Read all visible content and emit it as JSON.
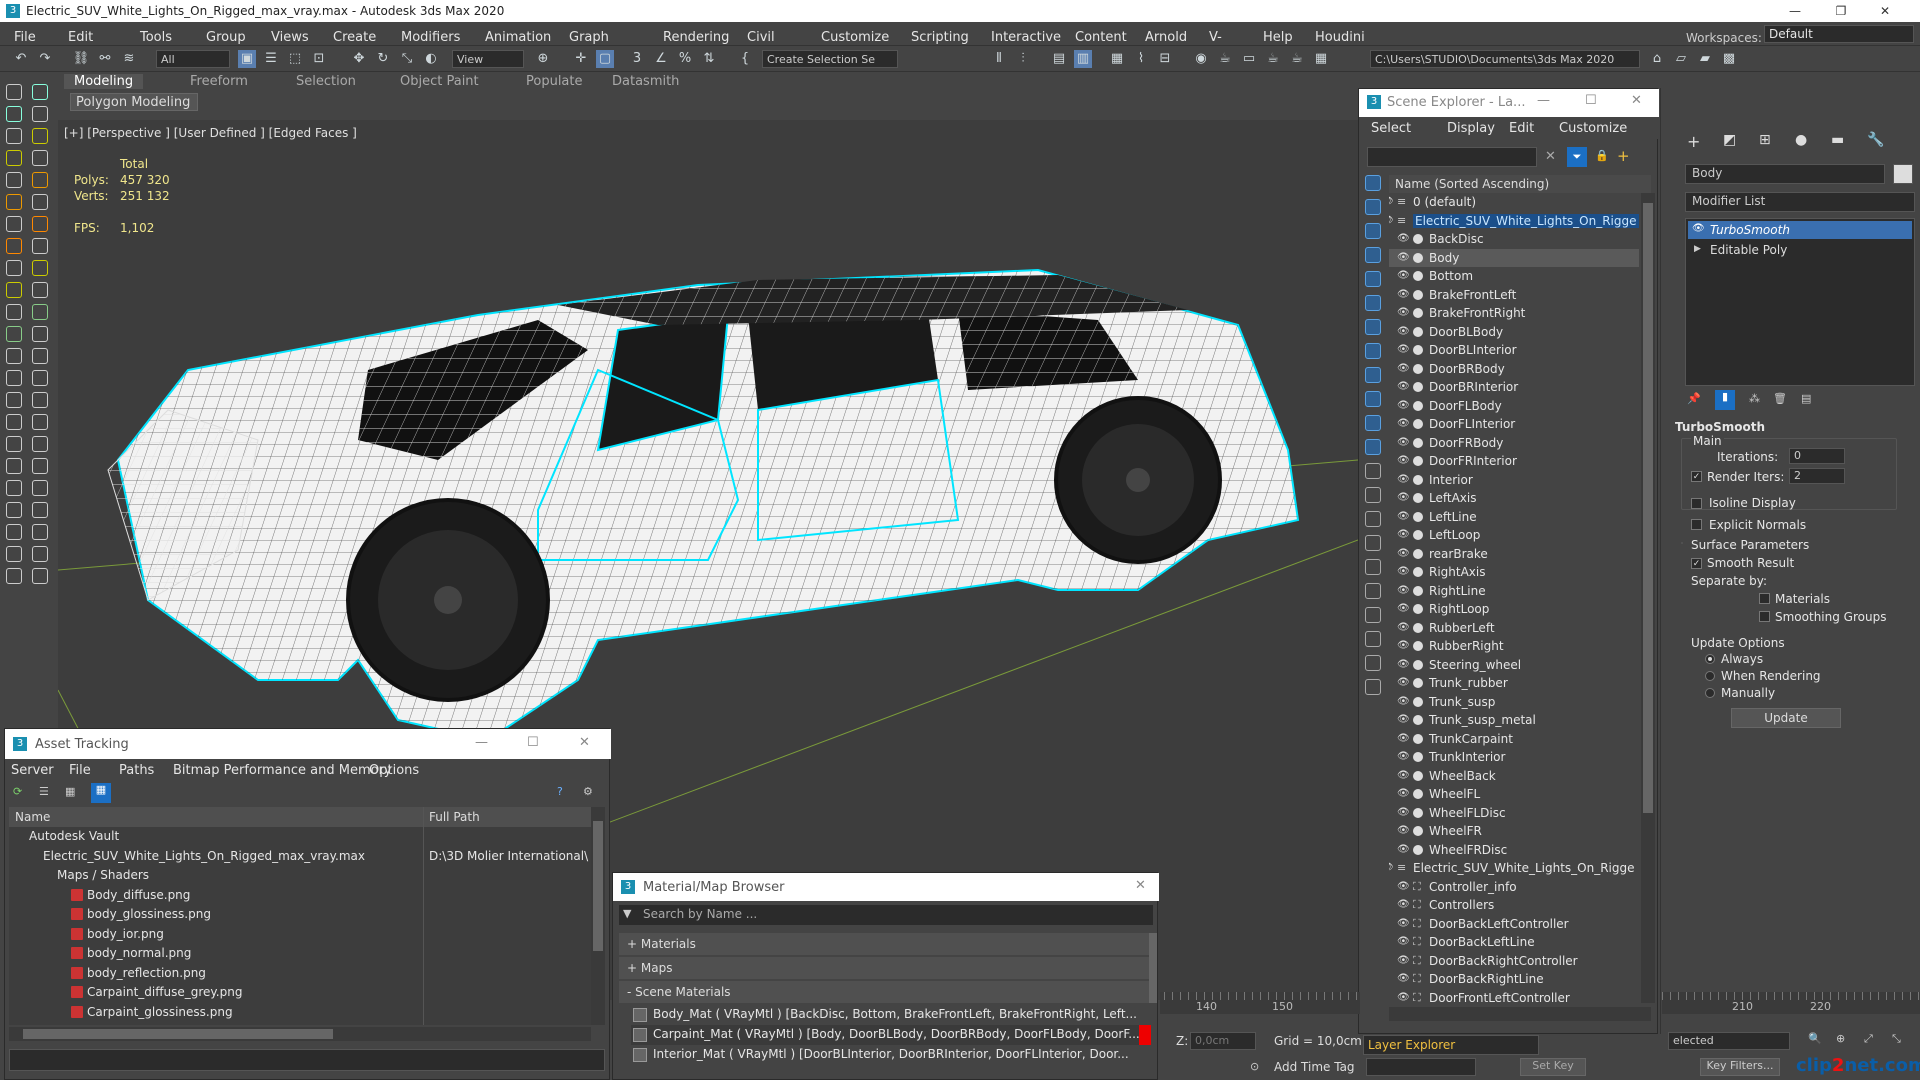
{
  "window": {
    "title": "Electric_SUV_White_Lights_On_Rigged_max_vray.max - Autodesk 3ds Max 2020"
  },
  "menu": [
    "File",
    "Edit",
    "Tools",
    "Group",
    "Views",
    "Create",
    "Modifiers",
    "Animation",
    "Graph Editors",
    "Rendering",
    "Civil View",
    "Customize",
    "Scripting",
    "Interactive",
    "Content",
    "Arnold",
    "V-Ray",
    "Help",
    "Houdini Engine"
  ],
  "workspaces": {
    "label": "Workspaces:",
    "value": "Default"
  },
  "toolbar": {
    "filter": "All",
    "view": "View",
    "selection_set": "Create Selection Se",
    "path": "C:\\Users\\STUDIO\\Documents\\3ds Max 2020"
  },
  "ribbon": {
    "tabs": [
      "Modeling",
      "Freeform",
      "Selection",
      "Object Paint",
      "Populate",
      "Datasmith"
    ],
    "sub": "Polygon Modeling"
  },
  "viewport": {
    "label": "[+] [Perspective ] [User Defined ] [Edged Faces ]",
    "stats": {
      "total": "Total",
      "polys_label": "Polys:",
      "polys": "457 320",
      "verts_label": "Verts:",
      "verts": "251 132",
      "fps_label": "FPS:",
      "fps": "1,102"
    }
  },
  "scene_explorer": {
    "title": "Scene Explorer - La...",
    "menu": [
      "Select",
      "Display",
      "Edit",
      "Customize"
    ],
    "column": "Name (Sorted Ascending)",
    "rows": [
      {
        "name": "0 (default)",
        "indent": 0,
        "type": "layer"
      },
      {
        "name": "Electric_SUV_White_Lights_On_Rigge",
        "indent": 0,
        "type": "layer-open",
        "hilite": true
      },
      {
        "name": "BackDisc",
        "indent": 1,
        "type": "obj"
      },
      {
        "name": "Body",
        "indent": 1,
        "type": "obj",
        "sel": true
      },
      {
        "name": "Bottom",
        "indent": 1,
        "type": "obj"
      },
      {
        "name": "BrakeFrontLeft",
        "indent": 1,
        "type": "obj"
      },
      {
        "name": "BrakeFrontRight",
        "indent": 1,
        "type": "obj"
      },
      {
        "name": "DoorBLBody",
        "indent": 1,
        "type": "obj"
      },
      {
        "name": "DoorBLInterior",
        "indent": 1,
        "type": "obj"
      },
      {
        "name": "DoorBRBody",
        "indent": 1,
        "type": "obj"
      },
      {
        "name": "DoorBRInterior",
        "indent": 1,
        "type": "obj"
      },
      {
        "name": "DoorFLBody",
        "indent": 1,
        "type": "obj"
      },
      {
        "name": "DoorFLInterior",
        "indent": 1,
        "type": "obj"
      },
      {
        "name": "DoorFRBody",
        "indent": 1,
        "type": "obj"
      },
      {
        "name": "DoorFRInterior",
        "indent": 1,
        "type": "obj"
      },
      {
        "name": "Interior",
        "indent": 1,
        "type": "obj"
      },
      {
        "name": "LeftAxis",
        "indent": 1,
        "type": "obj"
      },
      {
        "name": "LeftLine",
        "indent": 1,
        "type": "obj"
      },
      {
        "name": "LeftLoop",
        "indent": 1,
        "type": "obj"
      },
      {
        "name": "rearBrake",
        "indent": 1,
        "type": "obj"
      },
      {
        "name": "RightAxis",
        "indent": 1,
        "type": "obj"
      },
      {
        "name": "RightLine",
        "indent": 1,
        "type": "obj"
      },
      {
        "name": "RightLoop",
        "indent": 1,
        "type": "obj"
      },
      {
        "name": "RubberLeft",
        "indent": 1,
        "type": "obj"
      },
      {
        "name": "RubberRight",
        "indent": 1,
        "type": "obj"
      },
      {
        "name": "Steering_wheel",
        "indent": 1,
        "type": "obj"
      },
      {
        "name": "Trunk_rubber",
        "indent": 1,
        "type": "obj"
      },
      {
        "name": "Trunk_susp",
        "indent": 1,
        "type": "obj"
      },
      {
        "name": "Trunk_susp_metal",
        "indent": 1,
        "type": "obj"
      },
      {
        "name": "TrunkCarpaint",
        "indent": 1,
        "type": "obj"
      },
      {
        "name": "TrunkInterior",
        "indent": 1,
        "type": "obj"
      },
      {
        "name": "WheelBack",
        "indent": 1,
        "type": "obj"
      },
      {
        "name": "WheelFL",
        "indent": 1,
        "type": "obj"
      },
      {
        "name": "WheelFLDisc",
        "indent": 1,
        "type": "obj"
      },
      {
        "name": "WheelFR",
        "indent": 1,
        "type": "obj"
      },
      {
        "name": "WheelFRDisc",
        "indent": 1,
        "type": "obj"
      },
      {
        "name": "Electric_SUV_White_Lights_On_Rigge",
        "indent": 0,
        "type": "layer-open"
      },
      {
        "name": "Controller_info",
        "indent": 1,
        "type": "ctrl"
      },
      {
        "name": "Controllers",
        "indent": 1,
        "type": "ctrl"
      },
      {
        "name": "DoorBackLeftController",
        "indent": 1,
        "type": "ctrl"
      },
      {
        "name": "DoorBackLeftLine",
        "indent": 1,
        "type": "ctrl"
      },
      {
        "name": "DoorBackRightController",
        "indent": 1,
        "type": "ctrl"
      },
      {
        "name": "DoorBackRightLine",
        "indent": 1,
        "type": "ctrl"
      },
      {
        "name": "DoorFrontLeftController",
        "indent": 1,
        "type": "ctrl"
      }
    ],
    "footer": "Layer Explorer"
  },
  "command_panel": {
    "object_name": "Body",
    "modifier_list": "Modifier List",
    "stack": [
      "TurboSmooth",
      "Editable Poly"
    ],
    "rollout": "TurboSmooth",
    "main": "Main",
    "iterations_label": "Iterations:",
    "iterations": "0",
    "render_iters_label": "Render Iters:",
    "render_iters": "2",
    "isoline": "Isoline Display",
    "explicit_normals": "Explicit Normals",
    "surface_params": "Surface Parameters",
    "smooth_result": "Smooth Result",
    "separate_by": "Separate by:",
    "materials": "Materials",
    "smoothing_groups": "Smoothing Groups",
    "update_options": "Update Options",
    "always": "Always",
    "when_rendering": "When Rendering",
    "manually": "Manually",
    "update": "Update"
  },
  "asset_tracking": {
    "title": "Asset Tracking",
    "menu": [
      "Server",
      "File",
      "Paths",
      "Bitmap Performance and Memory",
      "Options"
    ],
    "columns": [
      "Name",
      "Full Path"
    ],
    "rows": [
      {
        "name": "Autodesk Vault",
        "indent": 1,
        "path": ""
      },
      {
        "name": "Electric_SUV_White_Lights_On_Rigged_max_vray.max",
        "indent": 2,
        "path": "D:\\3D Molier International\\"
      },
      {
        "name": "Maps / Shaders",
        "indent": 3,
        "path": ""
      },
      {
        "name": "Body_diffuse.png",
        "indent": 4,
        "path": "",
        "png": true
      },
      {
        "name": "body_glossiness.png",
        "indent": 4,
        "path": "",
        "png": true
      },
      {
        "name": "body_ior.png",
        "indent": 4,
        "path": "",
        "png": true
      },
      {
        "name": "body_normal.png",
        "indent": 4,
        "path": "",
        "png": true
      },
      {
        "name": "body_reflection.png",
        "indent": 4,
        "path": "",
        "png": true
      },
      {
        "name": "Carpaint_diffuse_grey.png",
        "indent": 4,
        "path": "",
        "png": true
      },
      {
        "name": "Carpaint_glossiness.png",
        "indent": 4,
        "path": "",
        "png": true
      }
    ]
  },
  "material_browser": {
    "title": "Material/Map Browser",
    "search": "Search by Name ...",
    "sections": [
      "+ Materials",
      "+ Maps",
      "- Scene Materials"
    ],
    "items": [
      "Body_Mat ( VRayMtl ) [BackDisc, Bottom, BrakeFrontLeft, BrakeFrontRight, Left...",
      "Carpaint_Mat ( VRayMtl ) [Body, DoorBLBody, DoorBRBody, DoorFLBody, DoorF...",
      "Interior_Mat ( VRayMtl ) [DoorBLInterior, DoorBRInterior, DoorFLInterior, Door..."
    ]
  },
  "status": {
    "z_label": "Z:",
    "z_value": "0,0cm",
    "grid": "Grid = 10,0cm",
    "add_time_tag": "Add Time Tag",
    "set_key": "Set Key",
    "key_filters": "Key Filters...",
    "selected": "elected",
    "ticks": [
      "140",
      "150",
      "210",
      "220"
    ]
  },
  "colors": {
    "accent": "#1b6fc4",
    "wire_select": "#00e5ff"
  }
}
